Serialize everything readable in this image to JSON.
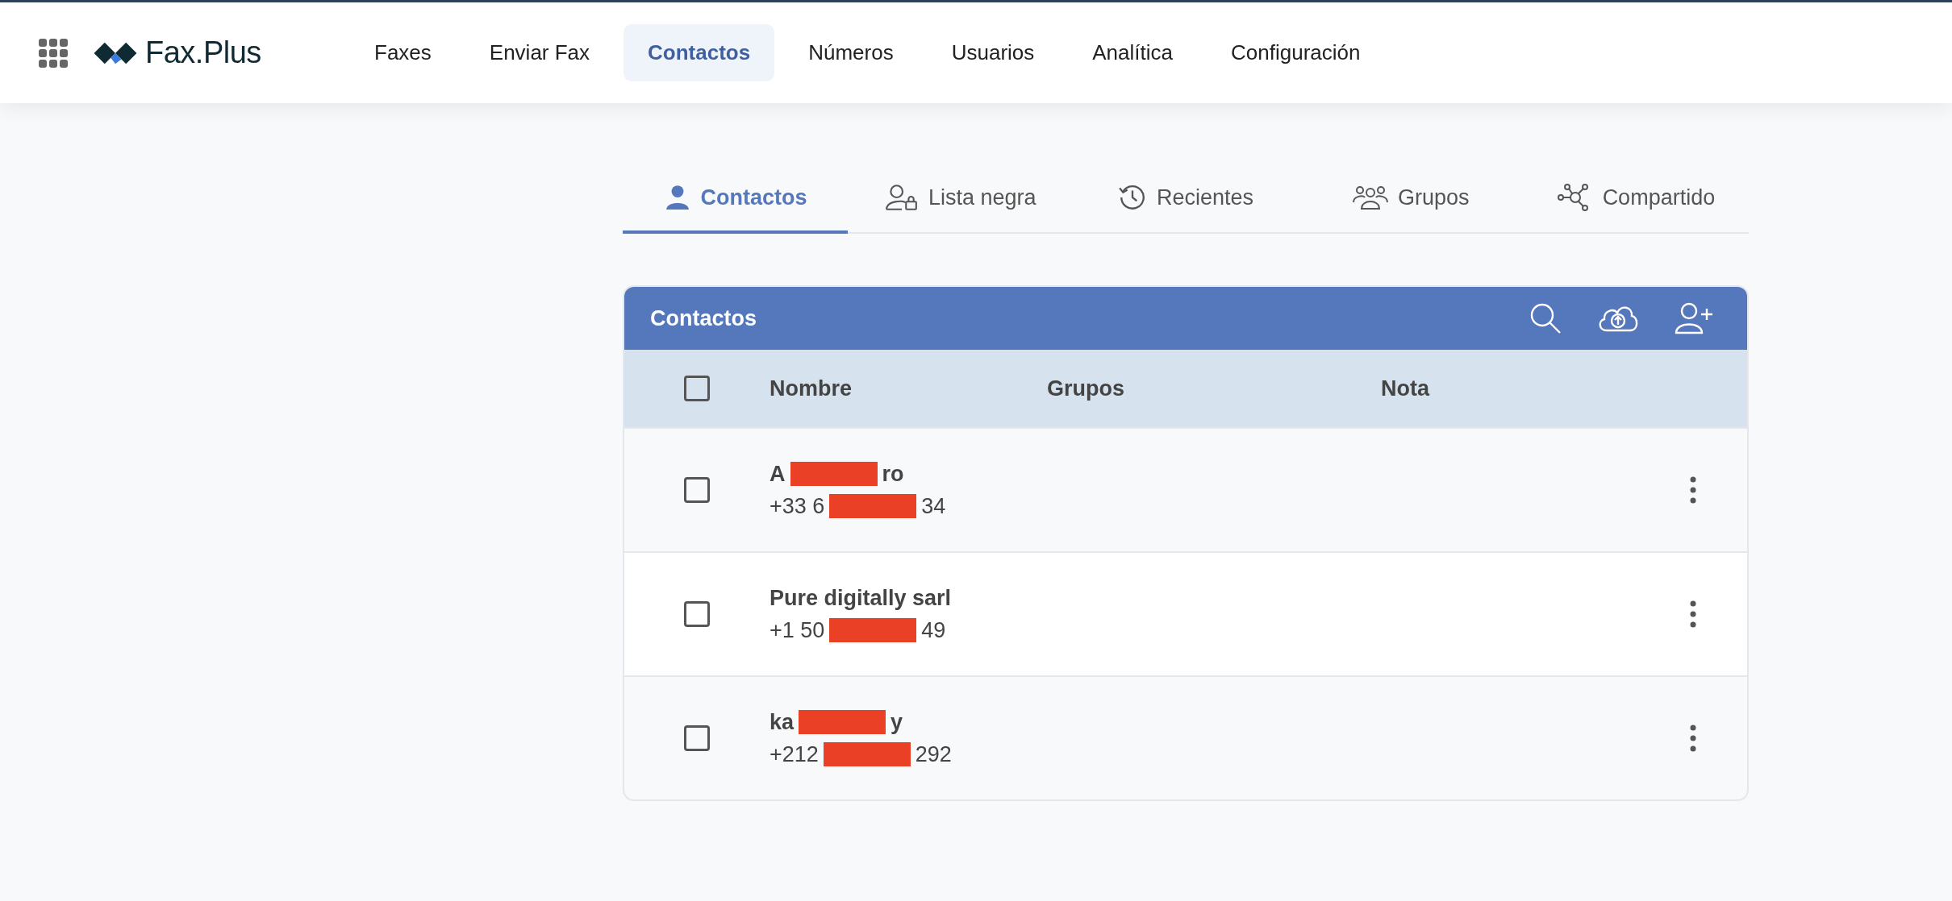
{
  "brand": {
    "name": "Fax.Plus"
  },
  "nav": [
    {
      "label": "Faxes",
      "selected": false
    },
    {
      "label": "Enviar Fax",
      "selected": false
    },
    {
      "label": "Contactos",
      "selected": true
    },
    {
      "label": "Números",
      "selected": false
    },
    {
      "label": "Usuarios",
      "selected": false
    },
    {
      "label": "Analítica",
      "selected": false
    },
    {
      "label": "Configuración",
      "selected": false
    }
  ],
  "tabs": [
    {
      "label": "Contactos",
      "kind": "person",
      "selected": true
    },
    {
      "label": "Lista negra",
      "kind": "blocked",
      "selected": false
    },
    {
      "label": "Recientes",
      "kind": "history",
      "selected": false
    },
    {
      "label": "Grupos",
      "kind": "group",
      "selected": false
    },
    {
      "label": "Compartido",
      "kind": "share",
      "selected": false
    }
  ],
  "table": {
    "title": "Contactos",
    "select_all": {
      "checked": false
    },
    "columns": [
      "Nombre",
      "Grupos",
      "Nota"
    ],
    "rows": [
      {
        "checked": false,
        "name": [
          {
            "kind": "text",
            "text": "A"
          },
          {
            "kind": "redaction"
          },
          {
            "kind": "text",
            "text": "ro"
          }
        ],
        "phone": [
          {
            "kind": "text",
            "text": "+33 6"
          },
          {
            "kind": "redaction"
          },
          {
            "kind": "text",
            "text": "34"
          }
        ]
      },
      {
        "checked": false,
        "name": [
          {
            "kind": "text",
            "text": "Pure digitally sarl"
          }
        ],
        "phone": [
          {
            "kind": "text",
            "text": "+1 50"
          },
          {
            "kind": "redaction"
          },
          {
            "kind": "text",
            "text": "49"
          }
        ]
      },
      {
        "checked": false,
        "name": [
          {
            "kind": "text",
            "text": "ka"
          },
          {
            "kind": "redaction"
          },
          {
            "kind": "text",
            "text": "y"
          }
        ],
        "phone": [
          {
            "kind": "text",
            "text": "+212"
          },
          {
            "kind": "redaction"
          },
          {
            "kind": "text",
            "text": "292"
          }
        ]
      }
    ]
  }
}
